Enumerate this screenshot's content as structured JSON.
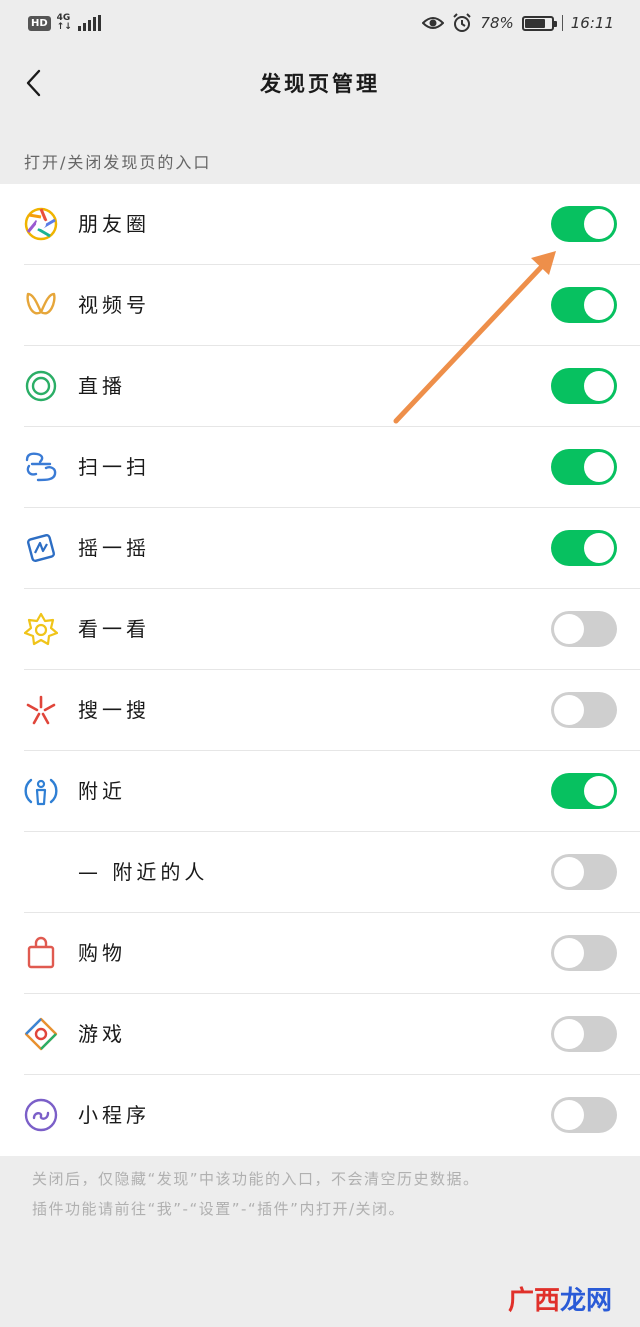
{
  "status_bar": {
    "hd": "HD",
    "network": "4G",
    "network_sub": "↑↓",
    "battery": "78%",
    "time": "16:11"
  },
  "nav": {
    "title": "发现页管理"
  },
  "section_caption": "打开/关闭发现页的入口",
  "items": [
    {
      "label": "朋友圈",
      "icon": "moments-icon",
      "on": true
    },
    {
      "label": "视频号",
      "icon": "channels-icon",
      "on": true
    },
    {
      "label": "直播",
      "icon": "live-icon",
      "on": true
    },
    {
      "label": "扫一扫",
      "icon": "scan-icon",
      "on": true
    },
    {
      "label": "摇一摇",
      "icon": "shake-icon",
      "on": true
    },
    {
      "label": "看一看",
      "icon": "top-stories-icon",
      "on": false
    },
    {
      "label": "搜一搜",
      "icon": "search-icon",
      "on": false
    },
    {
      "label": "附近",
      "icon": "nearby-icon",
      "on": true
    },
    {
      "label": "— 附近的人",
      "icon": "",
      "on": false
    },
    {
      "label": "购物",
      "icon": "shopping-bag-icon",
      "on": false
    },
    {
      "label": "游戏",
      "icon": "games-icon",
      "on": false
    },
    {
      "label": "小程序",
      "icon": "mini-programs-icon",
      "on": false
    }
  ],
  "footer": {
    "line1": "关闭后，仅隐藏“发现”中该功能的入口，不会清空历史数据。",
    "line2": "插件功能请前往“我”-“设置”-“插件”内打开/关闭。"
  },
  "watermark": {
    "part1": "广西",
    "part2": "龙网"
  },
  "colors": {
    "toggle_on": "#07c160",
    "toggle_off": "#cfcfcf",
    "arrow": "#ee8f4a",
    "background": "#ededed"
  }
}
